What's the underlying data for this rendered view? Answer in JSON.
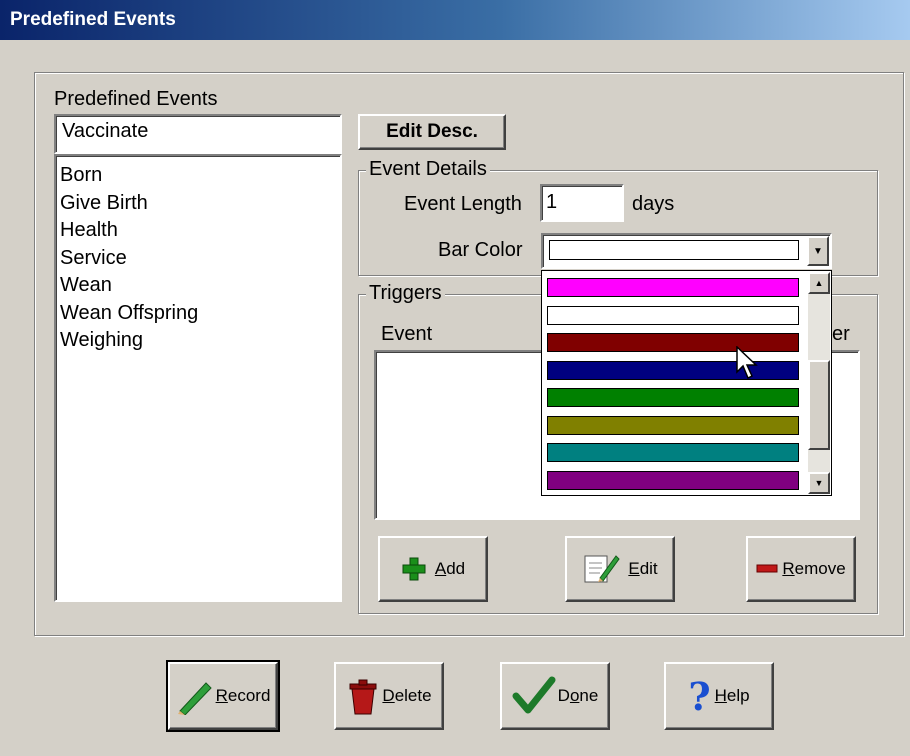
{
  "window": {
    "title": "Predefined Events"
  },
  "events_panel": {
    "label": "Predefined Events",
    "current_value": "Vaccinate",
    "items": [
      "Born",
      "Give Birth",
      "Health",
      "Service",
      "Wean",
      "Wean Offspring",
      "Weighing"
    ]
  },
  "edit_desc_button": {
    "label": "Edit Desc."
  },
  "event_details": {
    "title": "Event Details",
    "length_label": "Event Length",
    "length_value": "1",
    "length_unit": "days",
    "bar_color_label": "Bar Color",
    "bar_color_value": "#ffffff"
  },
  "color_dropdown": {
    "options": [
      {
        "color": "#ff00ff"
      },
      {
        "color": "#ffffff"
      },
      {
        "color": "#800000",
        "selected": true
      },
      {
        "color": "#000080"
      },
      {
        "color": "#008000"
      },
      {
        "color": "#808000"
      },
      {
        "color": "#008080"
      },
      {
        "color": "#800080"
      }
    ]
  },
  "triggers": {
    "title": "Triggers",
    "col_event": "Event",
    "col_partial": "er",
    "add_label_accel": "A",
    "add_label_rest": "dd",
    "edit_label_accel": "E",
    "edit_label_rest": "dit",
    "remove_label_accel": "R",
    "remove_label_rest": "emove"
  },
  "footer": {
    "record_accel": "R",
    "record_rest": "ecord",
    "delete_accel": "D",
    "delete_rest": "elete",
    "done_pre": "D",
    "done_accel": "o",
    "done_rest": "ne",
    "help_accel": "H",
    "help_rest": "elp"
  },
  "colors": {
    "title_bar_start": "#0a246a",
    "face": "#d4d0c8"
  }
}
